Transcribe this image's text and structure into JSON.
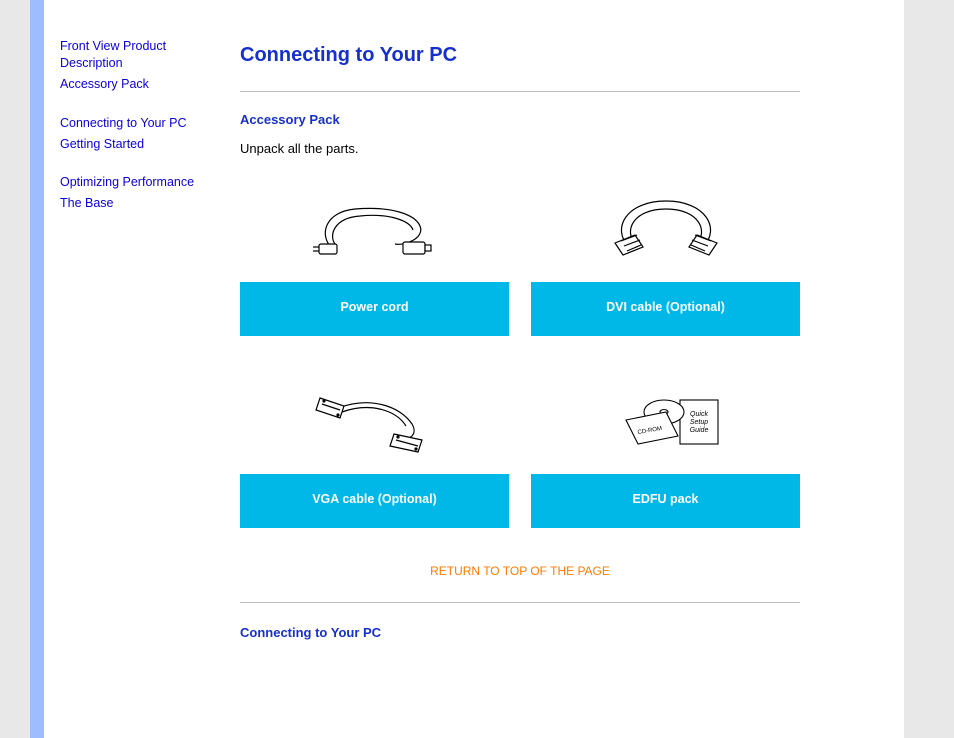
{
  "sidebar": {
    "groups": [
      {
        "items": [
          {
            "label": "Front View Product Description"
          },
          {
            "label": "Accessory Pack"
          }
        ]
      },
      {
        "items": [
          {
            "label": "Connecting to Your PC"
          },
          {
            "label": "Getting Started"
          }
        ]
      },
      {
        "items": [
          {
            "label": "Optimizing Performance"
          },
          {
            "label": "The Base"
          }
        ]
      }
    ]
  },
  "page": {
    "title": "Connecting to Your PC",
    "accessory_heading": "Accessory Pack",
    "unpack_text": "Unpack all the parts.",
    "return_link": "RETURN TO TOP OF THE PAGE",
    "connecting_heading": "Connecting to Your PC"
  },
  "accessories": [
    {
      "label": "Power cord",
      "icon": "power-cord"
    },
    {
      "label": "DVI cable (Optional)",
      "icon": "dvi-cable"
    },
    {
      "label": "VGA cable (Optional)",
      "icon": "vga-cable"
    },
    {
      "label": "EDFU pack",
      "icon": "edfu-pack"
    }
  ]
}
